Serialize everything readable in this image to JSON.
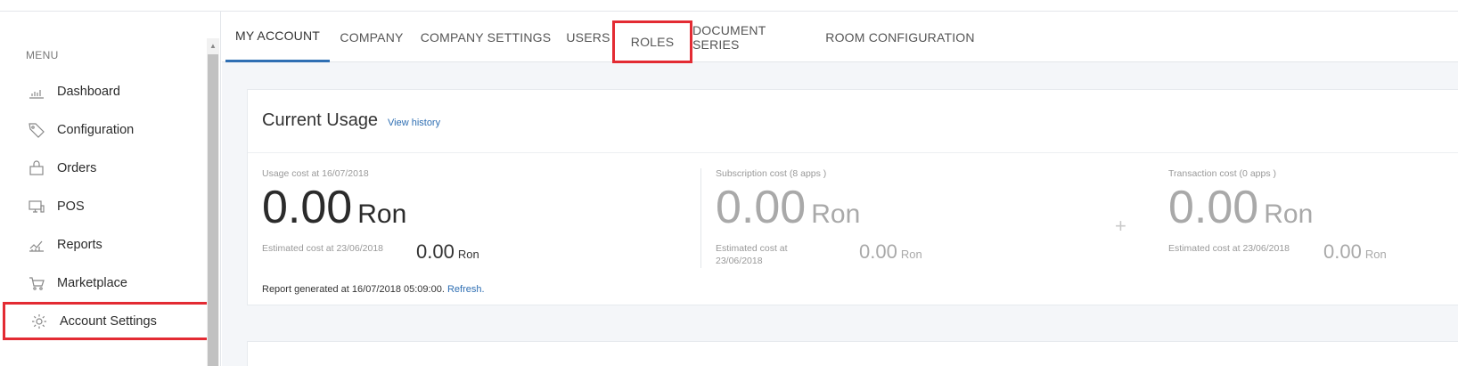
{
  "sidebar": {
    "menu_label": "MENU",
    "items": [
      {
        "label": "Dashboard",
        "icon": "bar-chart-icon"
      },
      {
        "label": "Configuration",
        "icon": "tag-icon"
      },
      {
        "label": "Orders",
        "icon": "shopping-bag-icon"
      },
      {
        "label": "POS",
        "icon": "monitor-icon"
      },
      {
        "label": "Reports",
        "icon": "line-chart-icon"
      },
      {
        "label": "Marketplace",
        "icon": "cart-icon"
      },
      {
        "label": "Account Settings",
        "icon": "gear-icon"
      }
    ]
  },
  "tabs": [
    {
      "label": "MY ACCOUNT"
    },
    {
      "label": "COMPANY"
    },
    {
      "label": "COMPANY SETTINGS"
    },
    {
      "label": "USERS"
    },
    {
      "label": "ROLES"
    },
    {
      "label": "DOCUMENT SERIES"
    },
    {
      "label": "ROOM CONFIGURATION"
    }
  ],
  "usage": {
    "title": "Current Usage",
    "view_history": "View history",
    "usage_cost": {
      "caption": "Usage cost at 16/07/2018",
      "value": "0.00",
      "unit": "Ron",
      "est_caption": "Estimated cost at 23/06/2018",
      "est_value": "0.00",
      "est_unit": "Ron"
    },
    "subscription_cost": {
      "caption": "Subscription cost (8 apps )",
      "value": "0.00",
      "unit": "Ron",
      "est_caption_line1": "Estimated cost at",
      "est_caption_line2": "23/06/2018",
      "est_value": "0.00",
      "est_unit": "Ron"
    },
    "plus_sign": "+",
    "transaction_cost": {
      "caption": "Transaction cost (0 apps )",
      "value": "0.00",
      "unit": "Ron",
      "est_caption": "Estimated cost at 23/06/2018",
      "est_value": "0.00",
      "est_unit": "Ron"
    },
    "report_text": "Report generated at 16/07/2018 05:09:00.",
    "refresh_label": "Refresh."
  },
  "colors": {
    "accent": "#2f6fb3",
    "highlight": "#e32b33"
  }
}
